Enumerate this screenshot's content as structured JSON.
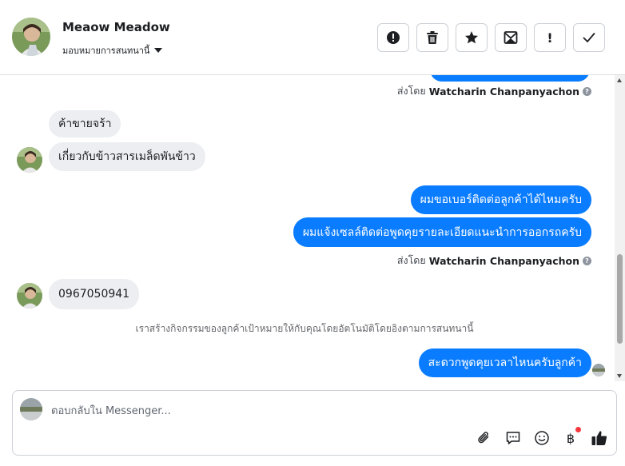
{
  "header": {
    "contact_name": "Meaow Meadow",
    "assign_label": "มอบหมายการสนทนานี้",
    "actions": [
      {
        "name": "report-icon",
        "label": ""
      },
      {
        "name": "trash-icon",
        "label": ""
      },
      {
        "name": "star-icon",
        "label": ""
      },
      {
        "name": "mark-unread-icon",
        "label": ""
      },
      {
        "name": "important-icon",
        "label": "!"
      },
      {
        "name": "checkmark-icon",
        "label": ""
      }
    ]
  },
  "thread": {
    "sent_by_prefix": "ส่งโดย",
    "agent_name": "Watcharin Chanpanyachon",
    "info_glyph": "?",
    "messages": [
      {
        "from": "customer",
        "text": "ค้าขายจร้า"
      },
      {
        "from": "customer",
        "text": "เกี่ยวกับข้าวสารเมล็ดพันข้าว"
      },
      {
        "from": "page",
        "text": "ผมขอเบอร์ติดต่อลูกค้าได้ไหมครับ"
      },
      {
        "from": "page",
        "text": "ผมแจ้งเซลล์ติดต่อพูดคุยรายละเอียดแนะนำการออกรถครับ"
      },
      {
        "from": "customer",
        "text": "0967050941"
      },
      {
        "from": "page",
        "text": "สะดวกพูดคุยเวลาไหนครับลูกค้า"
      }
    ],
    "system_note": "เราสร้างกิจกรรมของลูกค้าเป้าหมายให้กับคุณโดยอัตโนมัติโดยอิงตามการสนทนานี้"
  },
  "composer": {
    "placeholder": "ตอบกลับใน Messenger...",
    "value": "",
    "baht_symbol": "฿",
    "tools": [
      "paperclip-icon",
      "saved-reply-icon",
      "emoji-icon",
      "baht-icon",
      "thumbs-up-icon"
    ]
  },
  "colors": {
    "outgoing_bubble": "#0a7cff",
    "incoming_bubble": "#eceef1",
    "notification_dot": "#fa383e"
  }
}
